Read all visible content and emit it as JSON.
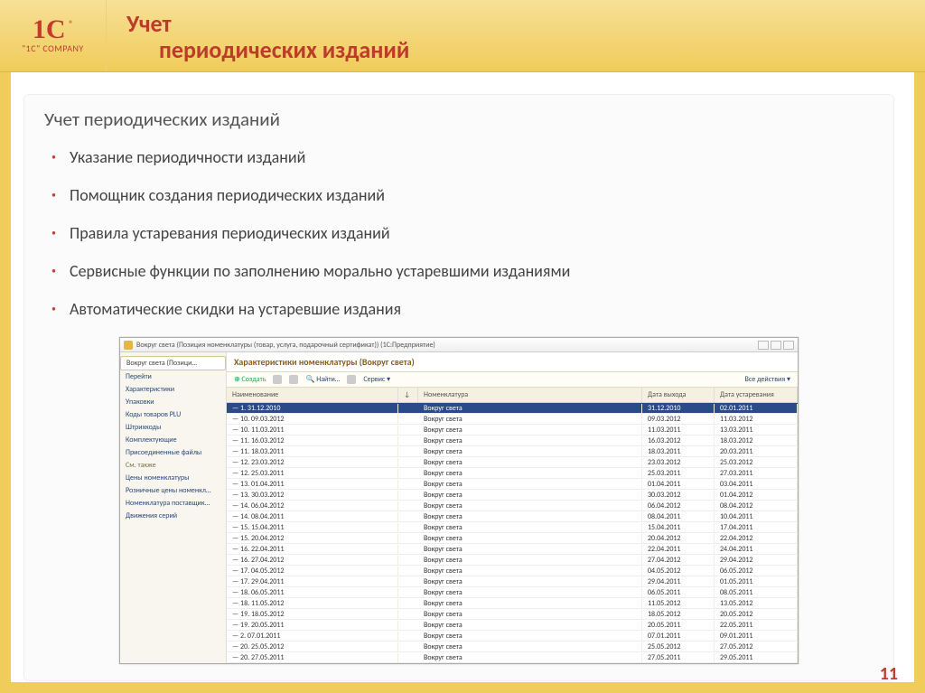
{
  "logo": {
    "brand": "1C",
    "reg": "®",
    "company": "\"1C\" COMPANY"
  },
  "slide": {
    "title1": "Учет",
    "title2": "периодических изданий",
    "section": "Учет периодических изданий",
    "bullets": [
      "Указание периодичности изданий",
      "Помощник создания периодических изданий",
      "Правила устаревания периодических изданий",
      "Сервисные функции по заполнению морально устаревшими изданиями",
      "Автоматические скидки на устаревшие издания"
    ],
    "page": "11"
  },
  "app": {
    "windowTitle": "Вокруг света (Позиция номенклатуры (товар, услуга, подарочный сертификат))  (1С:Предприятие)",
    "sidebar": {
      "selected": "Вокруг света (Позици…",
      "items": [
        "Перейти",
        "Характеристики",
        "Упаковки",
        "Коды товаров PLU",
        "Штрихкоды",
        "Комплектующие",
        "Присоединенные файлы"
      ],
      "group": "См. также",
      "items2": [
        "Цены номенклатуры",
        "Розничные цены номенкл…",
        "Номенклатура поставщик…",
        "Движения серий"
      ]
    },
    "mainTitle": "Характеристики номенклатуры (Вокруг света)",
    "toolbar": {
      "create": "Создать",
      "find": "Найти…",
      "service": "Сервис",
      "actions": "Все действия"
    },
    "columns": {
      "name": "Наименование",
      "key": "↓",
      "nom": "Номенклатура",
      "d1": "Дата выхода",
      "d2": "Дата устаревания"
    },
    "nomValue": "Вокруг света",
    "rows": [
      {
        "name": "1. 31.12.2010",
        "d1": "31.12.2010",
        "d2": "02.01.2011",
        "sel": true
      },
      {
        "name": "10. 09.03.2012",
        "d1": "09.03.2012",
        "d2": "11.03.2012"
      },
      {
        "name": "10. 11.03.2011",
        "d1": "11.03.2011",
        "d2": "13.03.2011"
      },
      {
        "name": "11. 16.03.2012",
        "d1": "16.03.2012",
        "d2": "18.03.2012"
      },
      {
        "name": "11. 18.03.2011",
        "d1": "18.03.2011",
        "d2": "20.03.2011"
      },
      {
        "name": "12. 23.03.2012",
        "d1": "23.03.2012",
        "d2": "25.03.2012"
      },
      {
        "name": "12. 25.03.2011",
        "d1": "25.03.2011",
        "d2": "27.03.2011"
      },
      {
        "name": "13. 01.04.2011",
        "d1": "01.04.2011",
        "d2": "03.04.2011"
      },
      {
        "name": "13. 30.03.2012",
        "d1": "30.03.2012",
        "d2": "01.04.2012"
      },
      {
        "name": "14. 06.04.2012",
        "d1": "06.04.2012",
        "d2": "08.04.2012"
      },
      {
        "name": "14. 08.04.2011",
        "d1": "08.04.2011",
        "d2": "10.04.2011"
      },
      {
        "name": "15. 15.04.2011",
        "d1": "15.04.2011",
        "d2": "17.04.2011"
      },
      {
        "name": "15. 20.04.2012",
        "d1": "20.04.2012",
        "d2": "22.04.2012"
      },
      {
        "name": "16. 22.04.2011",
        "d1": "22.04.2011",
        "d2": "24.04.2011"
      },
      {
        "name": "16. 27.04.2012",
        "d1": "27.04.2012",
        "d2": "29.04.2012"
      },
      {
        "name": "17. 04.05.2012",
        "d1": "04.05.2012",
        "d2": "06.05.2012"
      },
      {
        "name": "17. 29.04.2011",
        "d1": "29.04.2011",
        "d2": "01.05.2011"
      },
      {
        "name": "18. 06.05.2011",
        "d1": "06.05.2011",
        "d2": "08.05.2011"
      },
      {
        "name": "18. 11.05.2012",
        "d1": "11.05.2012",
        "d2": "13.05.2012"
      },
      {
        "name": "19. 18.05.2012",
        "d1": "18.05.2012",
        "d2": "20.05.2012"
      },
      {
        "name": "19. 20.05.2011",
        "d1": "20.05.2011",
        "d2": "22.05.2011"
      },
      {
        "name": "2. 07.01.2011",
        "d1": "07.01.2011",
        "d2": "09.01.2011"
      },
      {
        "name": "20. 25.05.2012",
        "d1": "25.05.2012",
        "d2": "27.05.2012"
      },
      {
        "name": "20. 27.05.2011",
        "d1": "27.05.2011",
        "d2": "29.05.2011"
      }
    ]
  }
}
